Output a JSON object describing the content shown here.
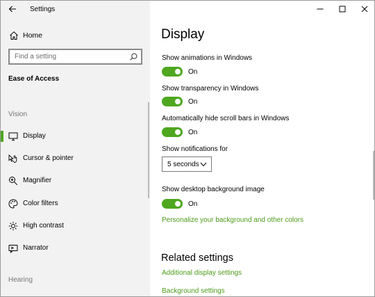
{
  "window": {
    "title": "Settings"
  },
  "sidebar": {
    "home_label": "Home",
    "search": {
      "placeholder": "Find a setting"
    },
    "section_title": "Ease of Access",
    "groups": [
      {
        "label": "Vision"
      },
      {
        "label": "Hearing"
      }
    ],
    "items": [
      {
        "label": "Display",
        "icon": "monitor-icon",
        "selected": true
      },
      {
        "label": "Cursor & pointer",
        "icon": "cursor-pointer-icon",
        "selected": false
      },
      {
        "label": "Magnifier",
        "icon": "magnifier-icon",
        "selected": false
      },
      {
        "label": "Color filters",
        "icon": "color-filters-icon",
        "selected": false
      },
      {
        "label": "High contrast",
        "icon": "high-contrast-icon",
        "selected": false
      },
      {
        "label": "Narrator",
        "icon": "narrator-icon",
        "selected": false
      }
    ]
  },
  "main": {
    "title": "Display",
    "settings": [
      {
        "label": "Show animations in Windows",
        "state": "On",
        "on": true
      },
      {
        "label": "Show transparency in Windows",
        "state": "On",
        "on": true
      },
      {
        "label": "Automatically hide scroll bars in Windows",
        "state": "On",
        "on": true
      },
      {
        "label": "Show desktop background image",
        "state": "On",
        "on": true
      }
    ],
    "notifications": {
      "label": "Show notifications for",
      "selected": "5 seconds"
    },
    "personalize_link": "Personalize your background and other colors",
    "related": {
      "title": "Related settings",
      "links": [
        "Additional display settings",
        "Background settings"
      ]
    }
  },
  "colors": {
    "accent": "#4ea71f",
    "link": "#4a9a17",
    "sidebar_bg": "#f2f2f2"
  }
}
